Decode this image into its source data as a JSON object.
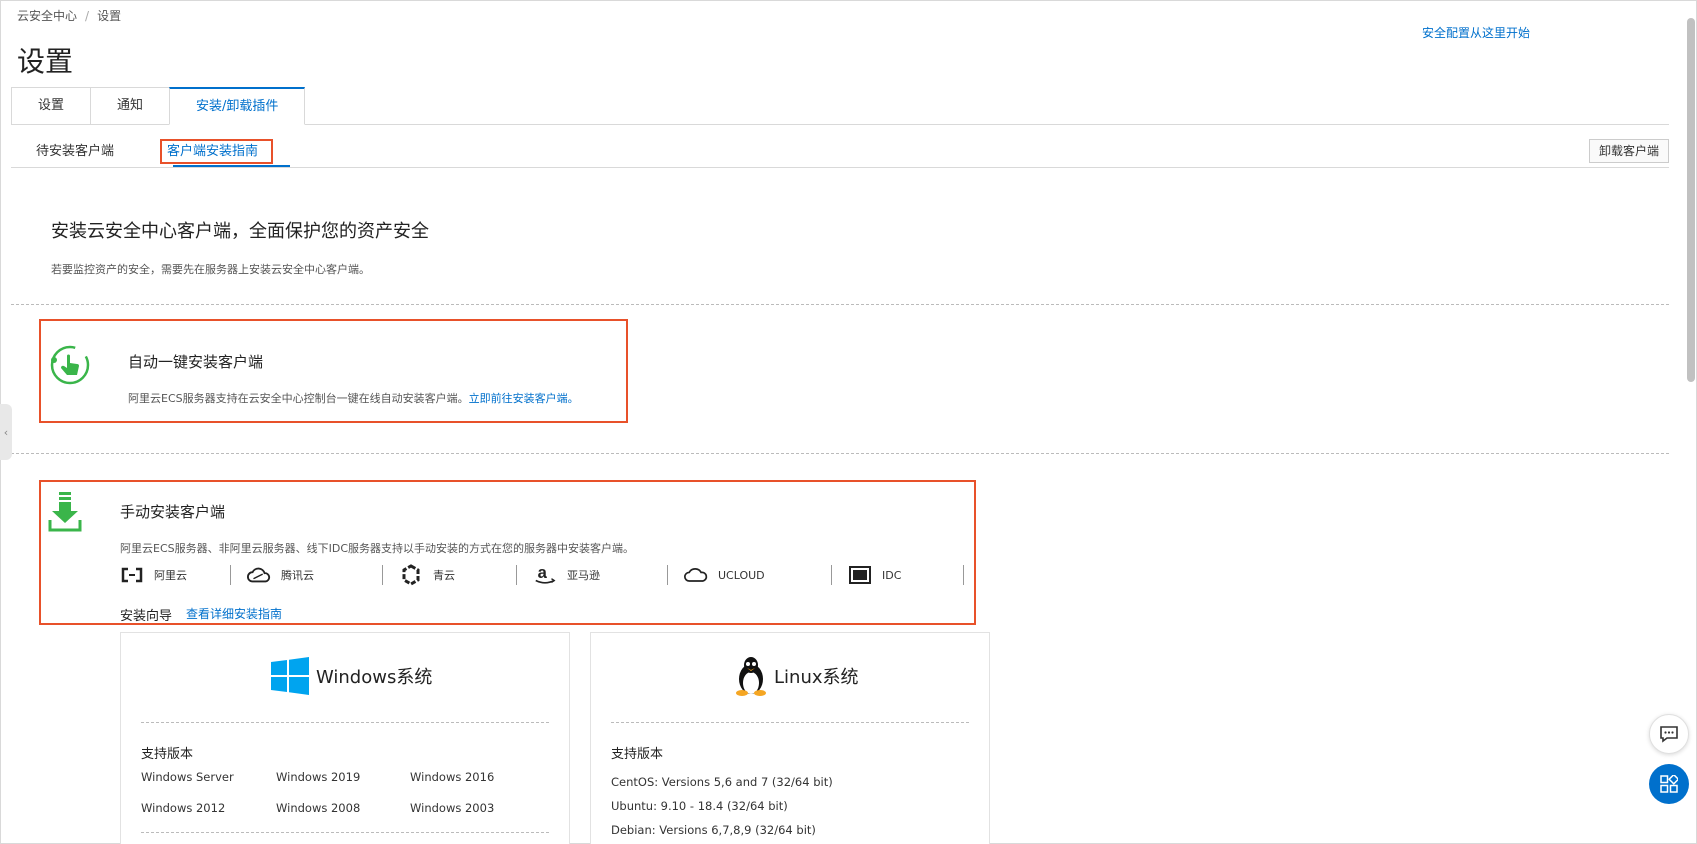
{
  "breadcrumb": {
    "root": "云安全中心",
    "separator": "/",
    "current": "设置"
  },
  "page_title": "设置",
  "top_link": "安全配置从这里开始",
  "main_tabs": [
    {
      "label": "设置",
      "active": false
    },
    {
      "label": "通知",
      "active": false
    },
    {
      "label": "安装/卸载插件",
      "active": true
    }
  ],
  "sub_tabs": [
    {
      "label": "待安装客户端",
      "active": false
    },
    {
      "label": "客户端安装指南",
      "active": true
    }
  ],
  "uninstall_button": "卸载客户端",
  "hero": {
    "title": "安装云安全中心客户端，全面保护您的资产安全",
    "desc": "若要监控资产的安全，需要先在服务器上安装云安全中心客户端。"
  },
  "auto_install": {
    "icon": "touch-install-icon",
    "title": "自动一键安装客户端",
    "desc": "阿里云ECS服务器支持在云安全中心控制台一键在线自动安装客户端。",
    "link": "立即前往安装客户端。"
  },
  "manual_install": {
    "icon": "download-icon",
    "title": "手动安装客户端",
    "desc": "阿里云ECS服务器、非阿里云服务器、线下IDC服务器支持以手动安装的方式在您的服务器中安装客户端。",
    "providers": [
      {
        "name": "阿里云",
        "icon": "aliyun-logo-icon"
      },
      {
        "name": "腾讯云",
        "icon": "tencent-cloud-icon"
      },
      {
        "name": "青云",
        "icon": "qingcloud-icon"
      },
      {
        "name": "亚马逊",
        "icon": "amazon-icon"
      },
      {
        "name": "UCLOUD",
        "icon": "ucloud-icon"
      },
      {
        "name": "IDC",
        "icon": "idc-icon"
      }
    ],
    "guide_label": "安装向导",
    "guide_link": "查看详细安装指南"
  },
  "windows_card": {
    "icon": "windows-logo-icon",
    "title": "Windows系统",
    "supported_label": "支持版本",
    "versions": [
      "Windows Server",
      "Windows 2019",
      "Windows 2016",
      "Windows 2012",
      "Windows 2008",
      "Windows 2003"
    ]
  },
  "linux_card": {
    "icon": "linux-penguin-icon",
    "title": "Linux系统",
    "supported_label": "支持版本",
    "versions": [
      "CentOS: Versions 5,6 and 7 (32/64 bit)",
      "Ubuntu: 9.10 - 18.4 (32/64 bit)",
      "Debian: Versions 6,7,8,9 (32/64 bit)"
    ]
  },
  "colors": {
    "accent": "#0070cc",
    "highlight": "#e8512a",
    "green": "#3ab54a",
    "windows": "#00a4ef"
  }
}
